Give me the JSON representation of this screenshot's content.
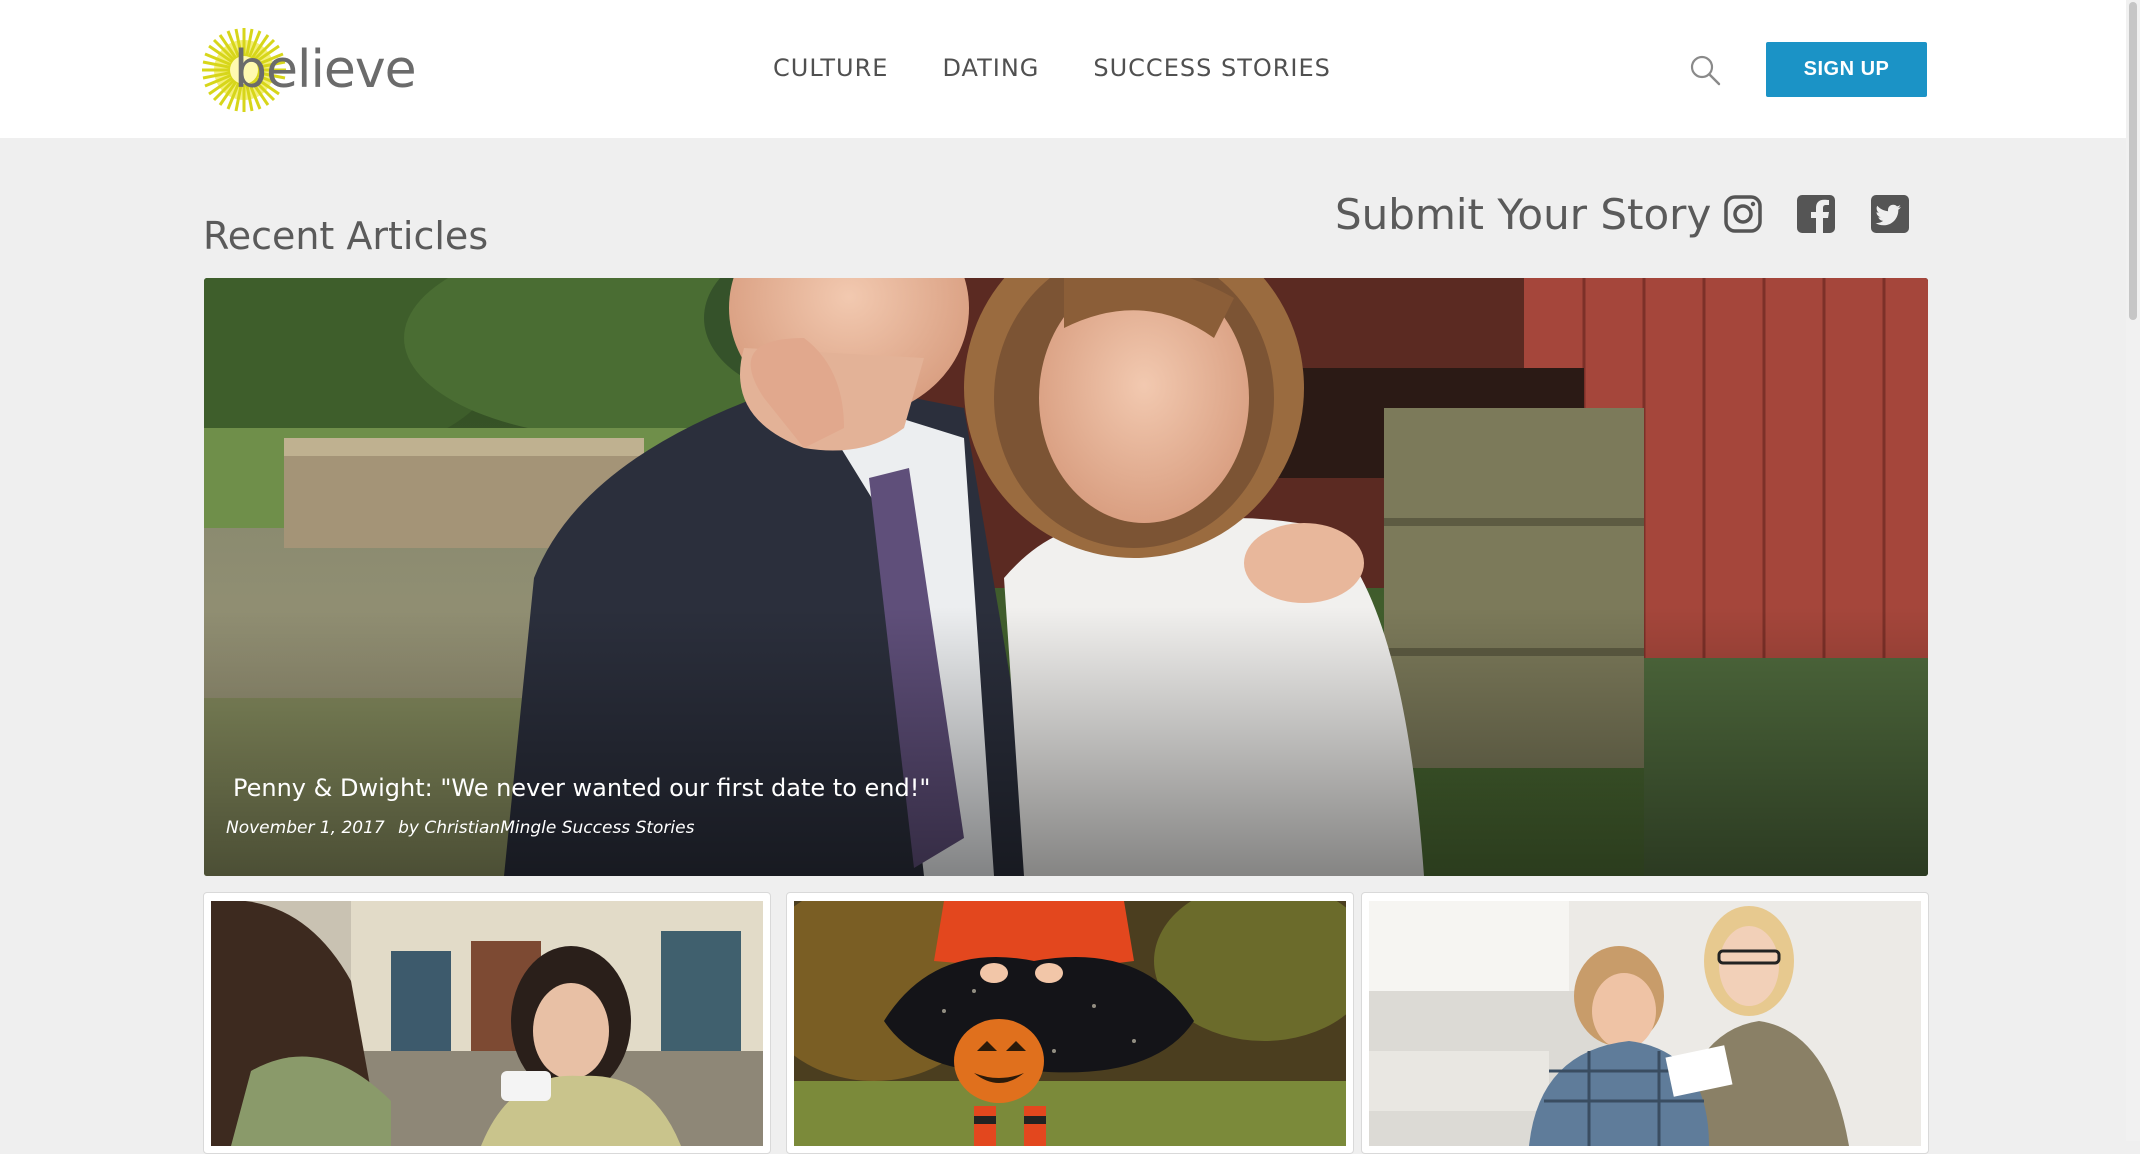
{
  "header": {
    "logo_text": "believe",
    "nav": [
      "CULTURE",
      "DATING",
      "SUCCESS STORIES"
    ],
    "signup_label": "SIGN UP",
    "accent_color": "#1b93c6"
  },
  "section": {
    "title": "Recent Articles",
    "submit_label": "Submit Your Story",
    "social_icons": [
      "instagram-icon",
      "facebook-icon",
      "twitter-icon"
    ]
  },
  "featured": {
    "title": "Penny & Dwight: \"We never wanted our first date to end!\"",
    "date": "November 1, 2017",
    "author": "by ChristianMingle Success Stories"
  },
  "cards": [
    {
      "image": "two-women-using-phones"
    },
    {
      "image": "child-halloween-pumpkin-bucket"
    },
    {
      "image": "couple-looking-at-documents"
    }
  ]
}
